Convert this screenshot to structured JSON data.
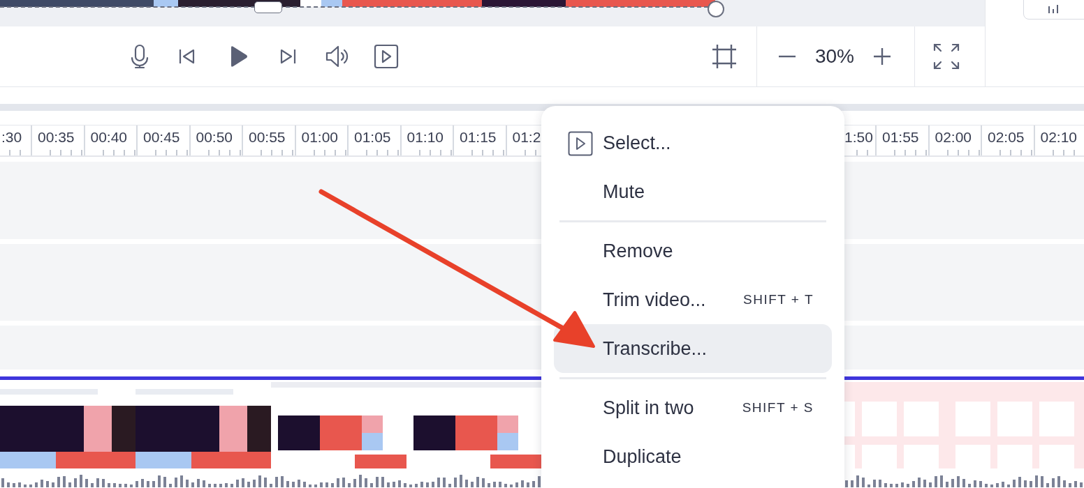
{
  "zoom": {
    "value": "30%"
  },
  "ruler": {
    "left_labels": [
      ":30",
      "00:35",
      "00:40",
      "00:45",
      "00:50",
      "00:55",
      "01:00",
      "01:05",
      "01:10",
      "01:15",
      "01:2"
    ],
    "right_labels": [
      "1:50",
      "01:55",
      "02:00",
      "02:05",
      "02:10"
    ]
  },
  "video_track": {
    "selected": true
  },
  "context_menu": [
    {
      "kind": "icon_item",
      "label": "Select...",
      "selected": false
    },
    {
      "kind": "item",
      "label": "Mute",
      "selected": false
    },
    {
      "kind": "divider"
    },
    {
      "kind": "item",
      "label": "Remove",
      "selected": false
    },
    {
      "kind": "item",
      "label": "Trim video...",
      "shortcut": "SHIFT + T",
      "selected": false
    },
    {
      "kind": "item",
      "label": "Transcribe...",
      "selected": true
    },
    {
      "kind": "divider"
    },
    {
      "kind": "item",
      "label": "Split in two",
      "shortcut": "SHIFT + S",
      "selected": false
    },
    {
      "kind": "item",
      "label": "Duplicate",
      "selected": false
    }
  ]
}
